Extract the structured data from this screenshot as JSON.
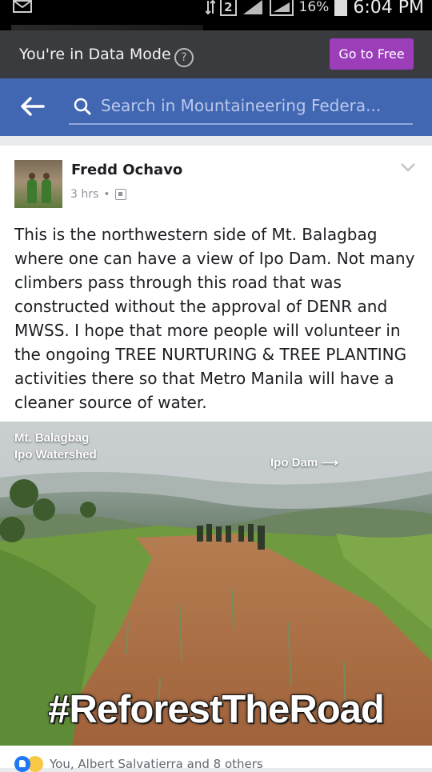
{
  "status_bar": {
    "notification_icon": "mail-icon",
    "sim_label": "2",
    "battery": "16%",
    "time": "6:04 PM"
  },
  "data_mode": {
    "text": "You're in Data Mode",
    "help_symbol": "?",
    "button": "Go to Free",
    "button_color": "#9c3dba"
  },
  "search": {
    "back_icon": "back-arrow-icon",
    "icon": "search-icon",
    "placeholder": "Search in Mountaineering Federa..."
  },
  "post": {
    "author": "Fredd Ochavo",
    "time": "3 hrs",
    "separator": "•",
    "privacy_icon": "group-privacy-icon",
    "text": "This is the northwestern side of Mt. Balagbag where one can have a view of Ipo Dam. Not many climbers pass through this road that was constructed without the approval of DENR and MWSS. I hope that more people will volunteer in the ongoing TREE NURTURING & TREE PLANTING activities there so that Metro Manila will have a cleaner source of water.",
    "image_caption_1": "Mt. Balagbag",
    "image_caption_2": "Ipo Watershed",
    "image_caption_3": "Ipo Dam",
    "image_arrow": "⟶",
    "image_hashtag": "#ReforestTheRoad",
    "reactions_text": "You, Albert Salvatierra and 8 others"
  },
  "colors": {
    "facebook_blue": "#4267b2",
    "data_mode_bar": "#3a3b3e"
  }
}
